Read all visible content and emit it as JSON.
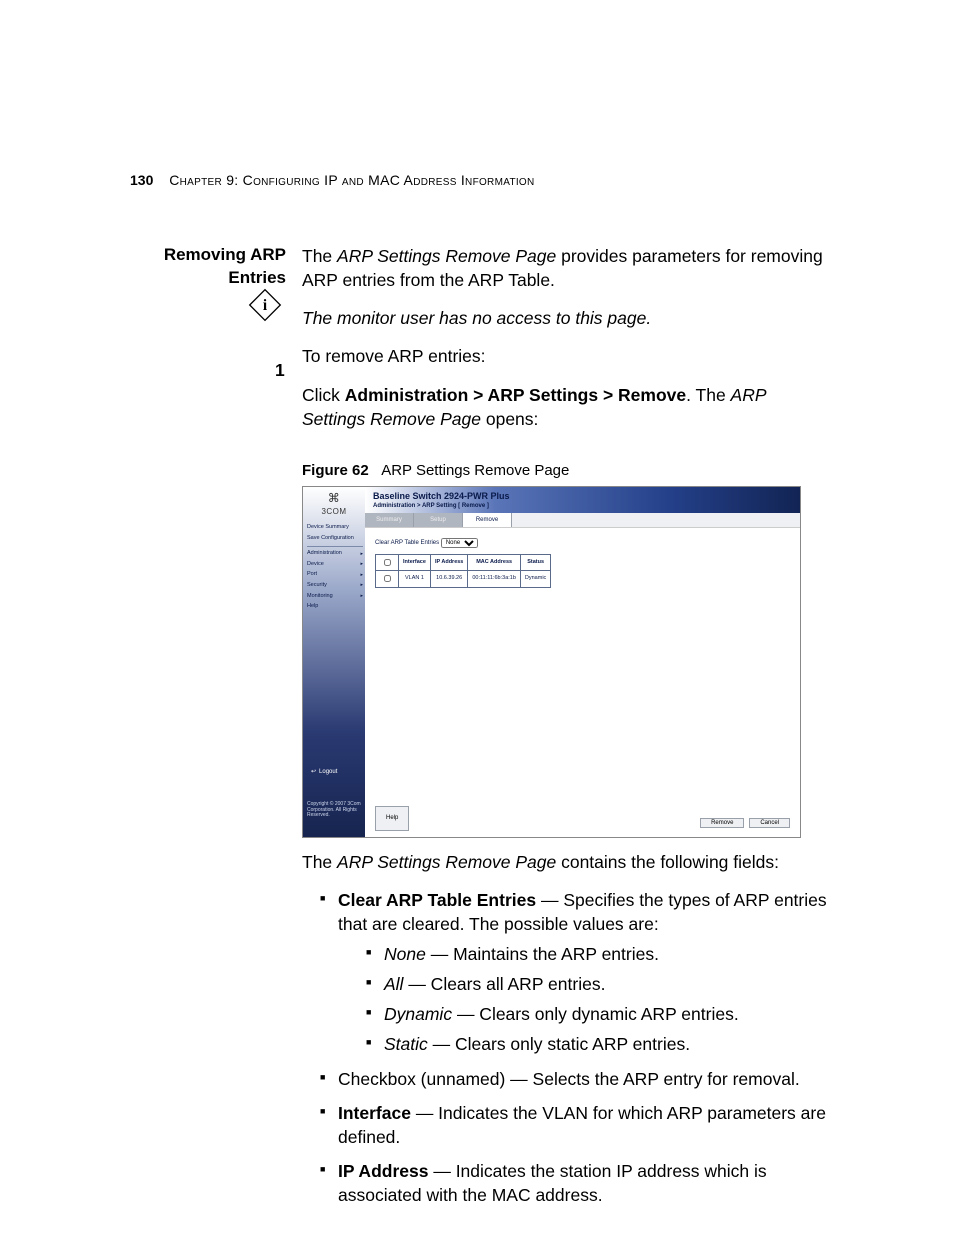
{
  "header": {
    "page_number": "130",
    "chapter_line": "Chapter 9: Configuring IP and MAC Address Information"
  },
  "side_heading": "Removing ARP Entries",
  "intro": {
    "lead_italic": "ARP Settings Remove Page",
    "lead_rest": " provides parameters for removing ARP entries from the ARP Table.",
    "lead_prefix": "The ",
    "note_italic": "The monitor user has no access to this page.",
    "to_remove": "To remove ARP entries:"
  },
  "step1": {
    "num": "1",
    "prefix": "Click ",
    "path_bold": "Administration > ARP Settings > Remove",
    "after1": ". The ",
    "page_ital": "ARP Settings Remove Page",
    "after2": " opens:"
  },
  "figure": {
    "label": "Figure 62",
    "caption": "ARP Settings Remove Page"
  },
  "shot": {
    "brand": "3COM",
    "product": "Baseline Switch 2924-PWR Plus",
    "breadcrumb": "Administration > ARP Setting [ Remove ]",
    "nav": {
      "a": "Device Summary",
      "b": "Save Configuration",
      "c": "Administration",
      "d": "Device",
      "e": "Port",
      "f": "Security",
      "g": "Monitoring",
      "h": "Help"
    },
    "logout": "Logout",
    "copyright": "Copyright © 2007 3Com Corporation. All Rights Reserved.",
    "tabs": {
      "a": "Summary",
      "b": "Setup",
      "c": "Remove"
    },
    "clear_label": "Clear ARP Table Entries",
    "clear_value": "None",
    "table": {
      "h_interface": "Interface",
      "h_ip": "IP Address",
      "h_mac": "MAC Address",
      "h_status": "Status",
      "r_interface": "VLAN 1",
      "r_ip": "10.6.39.26",
      "r_mac": "00:11:11:6b:3a:1b",
      "r_status": "Dynamic"
    },
    "btn_help": "Help",
    "btn_remove": "Remove",
    "btn_cancel": "Cancel"
  },
  "post": {
    "contains_prefix": "The ",
    "contains_ital": "ARP Settings Remove Page",
    "contains_rest": " contains the following fields:",
    "f_clear_b": "Clear ARP Table Entries",
    "f_clear_rest": " — Specifies the types of ARP entries that are cleared. The possible values are:",
    "v_none_i": "None",
    "v_none": " — Maintains the ARP entries.",
    "v_all_i": "All",
    "v_all": " — Clears all ARP entries.",
    "v_dyn_i": "Dynamic",
    "v_dyn": " — Clears only dynamic ARP entries.",
    "v_sta_i": "Static",
    "v_sta": " — Clears only static ARP entries.",
    "f_checkbox": "Checkbox (unnamed) — Selects the ARP entry for removal.",
    "f_iface_b": "Interface",
    "f_iface_rest": " — Indicates the VLAN for which ARP parameters are defined.",
    "f_ip_b": "IP Address",
    "f_ip_rest": " — Indicates the station IP address which is associated with the MAC address."
  }
}
